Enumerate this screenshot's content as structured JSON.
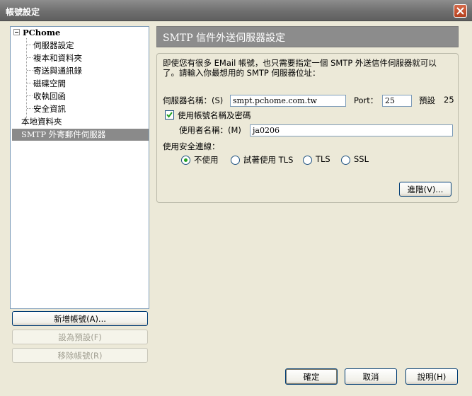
{
  "window": {
    "title": "帳號設定",
    "close_icon": "close-icon"
  },
  "tree": {
    "root_label": "PChome",
    "children": [
      "伺服器設定",
      "複本和資料夾",
      "寄送與通訊錄",
      "磁碟空間",
      "收執回函",
      "安全資訊"
    ],
    "local_folders": "本地資料夾",
    "smtp_item": "SMTP 外寄郵件伺服器"
  },
  "left_buttons": {
    "add": "新增帳號(A)...",
    "set_default": "設為預設(F)",
    "remove": "移除帳號(R)"
  },
  "header": {
    "title": "SMTP 信件外送伺服器設定"
  },
  "description": [
    "即使您有很多 EMail 帳號，也只需要指定一個 SMTP 外送信件伺服器就可以",
    "了。請輸入你最想用的 SMTP 伺服器位址："
  ],
  "server": {
    "label": "伺服器名稱：(S)",
    "value": "smpt.pchome.com.tw"
  },
  "port": {
    "label": "Port：",
    "value": "25",
    "default_label": "預設",
    "default_value": "25"
  },
  "use_auth": {
    "label": "使用帳號名稱及密碼",
    "checked": true
  },
  "username": {
    "label": "使用者名稱：(M)",
    "value": "ja0206"
  },
  "security": {
    "label": "使用安全連線：",
    "options": [
      "不使用",
      "試著使用 TLS",
      "TLS",
      "SSL"
    ],
    "selected": "不使用"
  },
  "advanced_button": "進階(V)...",
  "bottom_buttons": {
    "ok": "確定",
    "cancel": "取消",
    "help": "說明(H)"
  },
  "colors": {
    "header_bg": "#8c8c8c",
    "selection": "#8a8a8a",
    "check_mark": "#21a121"
  }
}
